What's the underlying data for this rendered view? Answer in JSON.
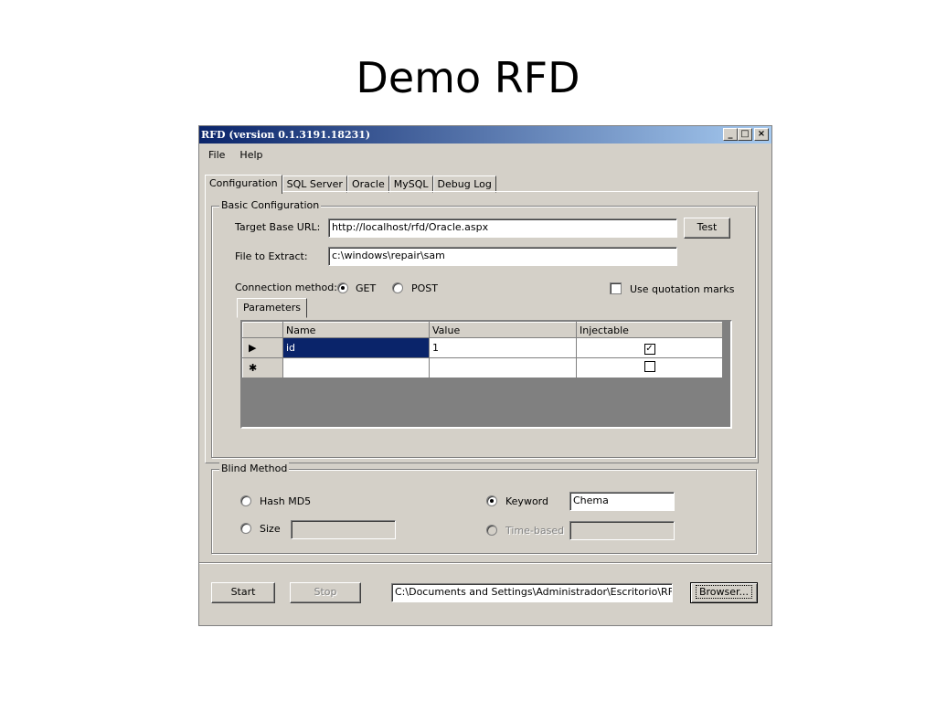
{
  "slide": {
    "title": "Demo RFD"
  },
  "window": {
    "title": "RFD (version 0.1.3191.18231)",
    "controls": {
      "minimize": "_",
      "maximize": "□",
      "close": "×"
    }
  },
  "menu": {
    "items": [
      "File",
      "Help"
    ]
  },
  "tabs": [
    "Configuration",
    "SQL Server",
    "Oracle",
    "MySQL",
    "Debug Log"
  ],
  "basic_config": {
    "group_title": "Basic Configuration",
    "target_label": "Target Base URL:",
    "target_value": "http://localhost/rfd/Oracle.aspx",
    "test_button": "Test",
    "file_label": "File to Extract:",
    "file_value": "c:\\windows\\repair\\sam",
    "method_label": "Connection method:",
    "method_get": "GET",
    "method_post": "POST",
    "quotes_label": "Use quotation marks",
    "params_tab": "Parameters",
    "grid": {
      "headers": [
        "Name",
        "Value",
        "Injectable"
      ],
      "rows": [
        {
          "marker": "▶",
          "name": "id",
          "value": "1",
          "injectable": true
        },
        {
          "marker": "✱",
          "name": "",
          "value": "",
          "injectable": false
        }
      ]
    }
  },
  "blind_method": {
    "group_title": "Blind Method",
    "hash_label": "Hash MD5",
    "size_label": "Size",
    "keyword_label": "Keyword",
    "keyword_value": "Chema",
    "time_label": "Time-based"
  },
  "footer": {
    "start_button": "Start",
    "stop_button": "Stop",
    "path_value": "C:\\Documents and Settings\\Administrador\\Escritorio\\RFD\\",
    "browse_button": "Browser..."
  }
}
